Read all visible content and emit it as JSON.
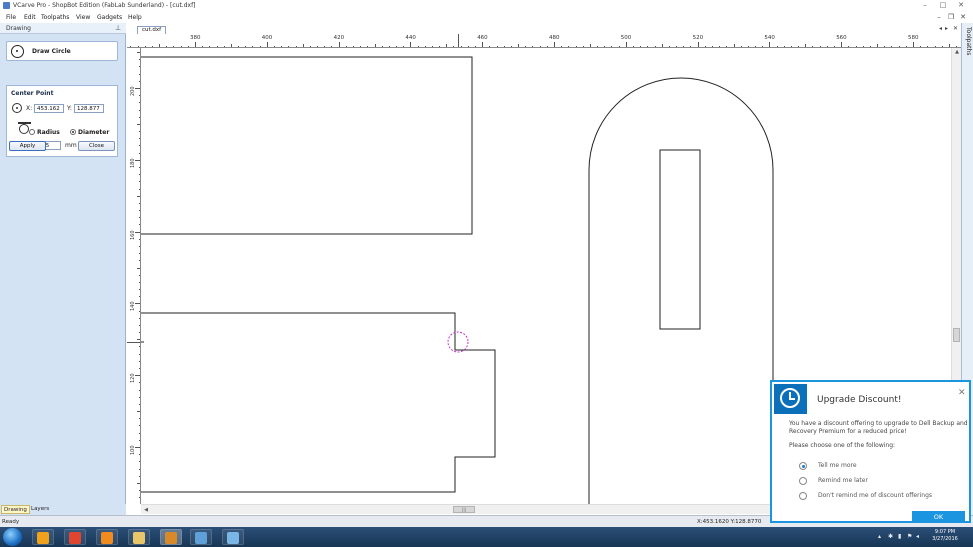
{
  "titlebar": {
    "title": "VCarve Pro - ShopBot Edition (FabLab Sunderland) - [cut.dxf]",
    "minimize": "–",
    "maximize": "□",
    "close": "✕"
  },
  "menubar": {
    "items": [
      "File",
      "Edit",
      "Toolpaths",
      "View",
      "Gadgets",
      "Help"
    ],
    "mdi_minimize": "–",
    "mdi_restore": "❐",
    "mdi_close": "✕"
  },
  "left_panel": {
    "header": "Drawing",
    "pin_icon": "pin-icon",
    "tool_name": "Draw Circle",
    "group_title": "Center Point",
    "x_label": "X:",
    "x_value": "453.162",
    "y_label": "Y:",
    "y_value": "128.877",
    "radius_label": "Radius",
    "diameter_label": "Diameter",
    "diameter_selected": true,
    "d_label": "D:",
    "d_value": "6.35",
    "unit": "mm",
    "apply_label": "Apply",
    "close_label": "Close",
    "tabs": [
      "Drawing",
      "Layers"
    ]
  },
  "document": {
    "tab_label": "cut.dxf",
    "nav_left": "◂",
    "nav_right": "▸",
    "nav_close": "✕"
  },
  "ruler": {
    "h_labels": [
      "380",
      "400",
      "420",
      "440",
      "460",
      "480",
      "500",
      "520",
      "540",
      "560",
      "580"
    ],
    "v_labels": [
      "200",
      "180",
      "160",
      "140",
      "120",
      "100"
    ]
  },
  "right_panel": {
    "label": "Toolpaths"
  },
  "status": {
    "ready": "Ready",
    "coords": "X:453.1620 Y:128.8770"
  },
  "taskbar": {
    "time": "9:07 PM",
    "date": "3/27/2016",
    "apps": [
      {
        "name": "media-player-icon",
        "color": "#f0a21d"
      },
      {
        "name": "chrome-icon",
        "color": "#e0452f"
      },
      {
        "name": "firefox-icon",
        "color": "#f28b1f"
      },
      {
        "name": "file-explorer-icon",
        "color": "#e9c66a"
      },
      {
        "name": "vcarve-icon",
        "color": "#d88a2a"
      },
      {
        "name": "globe-icon",
        "color": "#5fa0d8"
      },
      {
        "name": "app-icon",
        "color": "#7ab6e6"
      }
    ]
  },
  "popup": {
    "title": "Upgrade Discount!",
    "message": "You have a discount offering to upgrade to Dell Backup and Recovery Premium for a reduced price!",
    "prompt": "Please choose one of the following:",
    "options": [
      "Tell me more",
      "Remind me later",
      "Don't remind me of discount offerings"
    ],
    "selected_option": 0,
    "ok_label": "OK",
    "close": "✕"
  },
  "colors": {
    "accent": "#1b95e0",
    "panel_bg": "#d4e3f4",
    "taskbar": "#1f4066",
    "snap_circle": "#cc33cc"
  }
}
